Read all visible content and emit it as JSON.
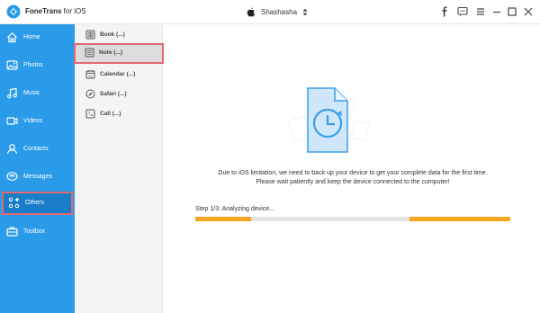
{
  "app": {
    "title_brand": "FoneTrans",
    "title_suffix": " for iOS"
  },
  "device": {
    "name": "Shashasha"
  },
  "window_controls": [
    "facebook-icon",
    "feedback-icon",
    "menu-icon",
    "minimize-icon",
    "maximize-icon",
    "close-icon"
  ],
  "sidebar": {
    "items": [
      {
        "label": "Home",
        "icon": "home-icon"
      },
      {
        "label": "Photos",
        "icon": "photo-icon"
      },
      {
        "label": "Music",
        "icon": "music-icon"
      },
      {
        "label": "Videos",
        "icon": "video-icon"
      },
      {
        "label": "Contacts",
        "icon": "contacts-icon"
      },
      {
        "label": "Messages",
        "icon": "messages-icon"
      },
      {
        "label": "Others",
        "icon": "others-icon",
        "active": true
      },
      {
        "label": "Toolbox",
        "icon": "toolbox-icon"
      }
    ]
  },
  "subcategories": {
    "items": [
      {
        "label": "Book (...)",
        "icon": "book-icon"
      },
      {
        "label": "Note (...)",
        "icon": "note-icon",
        "active": true
      },
      {
        "label": "Calendar (...)",
        "icon": "calendar-icon"
      },
      {
        "label": "Safari (...)",
        "icon": "safari-icon"
      },
      {
        "label": "Call (...)",
        "icon": "call-icon"
      }
    ]
  },
  "main": {
    "message_line1": "Due to iOS limitation, we need to back up your device to get your complete data for the first time.",
    "message_line2": "Please wait patiently and keep the device connected to the computer!",
    "step_text": "Step 1/3: Analyzing device...",
    "progress_state": "indeterminate"
  },
  "colors": {
    "sidebar_bg": "#2a9be9",
    "sidebar_active": "#1a7dc9",
    "highlight_border": "#e06a74",
    "progress_fill": "#f5a623",
    "progress_track": "#e3e3e3"
  }
}
